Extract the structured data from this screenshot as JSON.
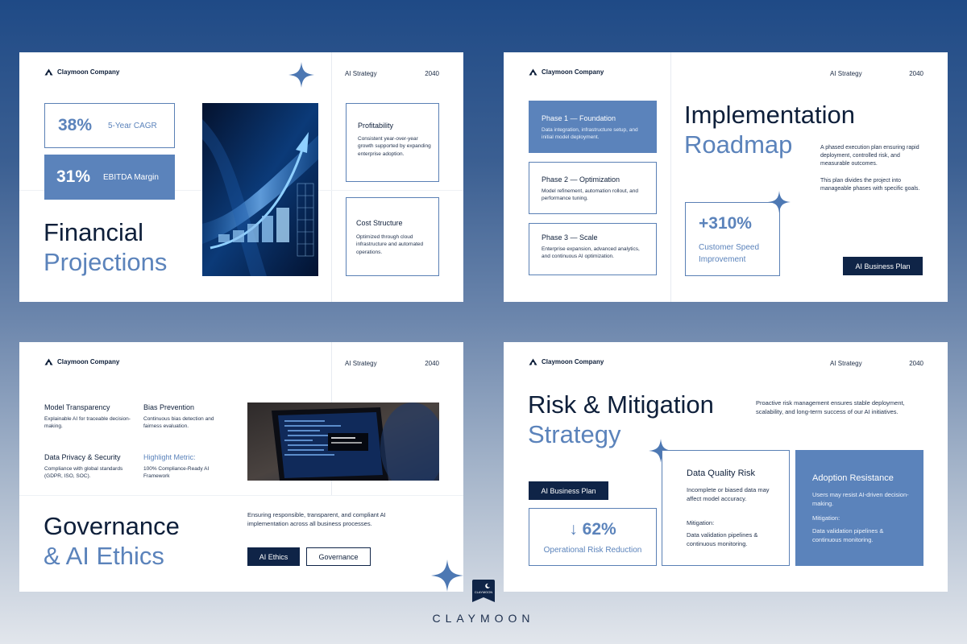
{
  "brand": {
    "name": "Claymoon Company",
    "footer_wordmark": "CLAYMOON",
    "footer_badge": "CLAYMOON"
  },
  "colors": {
    "accent": "#5b83bb",
    "navy": "#0f2447",
    "sparkle": "#4d78b3"
  },
  "header": {
    "strategy": "AI Strategy",
    "year": "2040"
  },
  "slide1": {
    "stat1": {
      "value": "38%",
      "label": "5-Year CAGR"
    },
    "stat2": {
      "value": "31%",
      "label": "EBITDA Margin"
    },
    "title_line1": "Financial",
    "title_line2": "Projections",
    "card1": {
      "title": "Profitability",
      "body": "Consistent year-over-year growth supported by expanding enterprise adoption."
    },
    "card2": {
      "title": "Cost Structure",
      "body": "Optimized through cloud infrastructure and automated operations."
    }
  },
  "slide2": {
    "phases": [
      {
        "title": "Phase 1 — Foundation",
        "body": "Data integration, infrastructure setup, and initial model deployment."
      },
      {
        "title": "Phase 2 — Optimization",
        "body": "Model refinement, automation rollout, and performance tuning."
      },
      {
        "title": "Phase 3 — Scale",
        "body": "Enterprise expansion, advanced analytics, and continuous AI optimization."
      }
    ],
    "title_line1": "Implementation",
    "title_line2": "Roadmap",
    "para1": "A phased execution plan ensuring rapid deployment, controlled risk, and measurable outcomes.",
    "para2": "This plan divides the project into manageable phases with specific goals.",
    "metric": {
      "value": "+310%",
      "label": "Customer Speed Improvement"
    },
    "button": "AI Business Plan"
  },
  "slide3": {
    "items": [
      {
        "title": "Model Transparency",
        "body": "Explainable AI for traceable decision-making."
      },
      {
        "title": "Bias Prevention",
        "body": "Continuous bias detection and fairness evaluation."
      },
      {
        "title": "Data Privacy & Security",
        "body": "Compliance with global standards (GDPR, ISO, SOC)."
      },
      {
        "title": "Highlight Metric:",
        "body": "100% Compliance-Ready AI Framework"
      }
    ],
    "title_line1": "Governance",
    "title_line2": "& AI Ethics",
    "para": "Ensuring responsible, transparent, and compliant AI implementation across all business processes.",
    "button1": "AI Ethics",
    "button2": "Governance"
  },
  "slide4": {
    "title_line1": "Risk & Mitigation",
    "title_line2": "Strategy",
    "para": "Proactive risk management ensures stable deployment, scalability, and long-term success of our AI initiatives.",
    "button": "AI Business Plan",
    "metric": {
      "arrow": "↓",
      "value": "62%",
      "label": "Operational Risk Reduction"
    },
    "card1": {
      "title": "Data Quality Risk",
      "body": "Incomplete or biased data may affect model accuracy.",
      "mit_label": "Mitigation:",
      "mit_body": "Data validation pipelines & continuous monitoring."
    },
    "card2": {
      "title": "Adoption Resistance",
      "body": "Users may resist AI-driven decision-making.",
      "mit_label": "Mitigation:",
      "mit_body": "Data validation pipelines & continuous monitoring."
    }
  }
}
